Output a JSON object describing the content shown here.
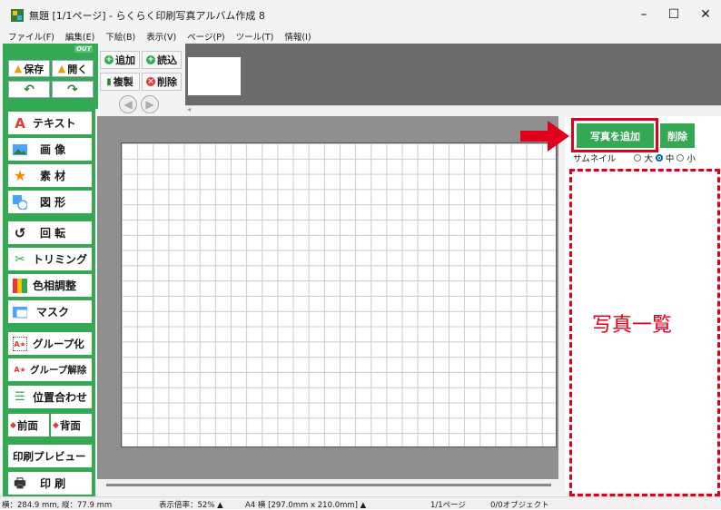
{
  "window": {
    "title": "無題 [1/1ページ] - らくらく印刷写真アルバム作成 8",
    "controls": {
      "minimize": "–",
      "maximize": "☐",
      "close": "✕"
    }
  },
  "menu": [
    "ファイル(F)",
    "編集(E)",
    "下絵(B)",
    "表示(V)",
    "ページ(P)",
    "ツール(T)",
    "情報(I)"
  ],
  "toolbar": {
    "out_label": "OUT",
    "save": "保存",
    "open": "開く",
    "undo": "↶",
    "redo": "↷",
    "add": "追加",
    "load": "読込",
    "duplicate": "複製",
    "delete": "削除",
    "prev": "◀",
    "next": "▶"
  },
  "sidebar": [
    {
      "label": "テキスト",
      "icon": "A"
    },
    {
      "label": "画 像",
      "icon": "image-icon"
    },
    {
      "label": "素 材",
      "icon": "★"
    },
    {
      "label": "図 形",
      "icon": "shape-icon"
    },
    {
      "label": "回 転",
      "icon": "rotate-icon"
    },
    {
      "label": "トリミング",
      "icon": "scissors-icon"
    },
    {
      "label": "色相調整",
      "icon": "color-icon"
    },
    {
      "label": "マスク",
      "icon": "mask-icon"
    },
    {
      "label": "グループ化",
      "icon": "group-icon"
    },
    {
      "label": "グループ解除",
      "icon": "ungroup-icon"
    },
    {
      "label": "位置合わせ",
      "icon": "align-icon"
    },
    {
      "label": "印刷プレビュー",
      "icon": ""
    },
    {
      "label": "印 刷",
      "icon": "printer-icon"
    }
  ],
  "front_back": {
    "front": "前面",
    "back": "背面"
  },
  "right_panel": {
    "add_photo": "写真を追加",
    "delete": "削除",
    "thumb_size_label": "サムネイル",
    "size_large": "大",
    "size_medium": "中",
    "size_small": "小",
    "photo_list": "写真一覧"
  },
  "status": {
    "coords": "横：284.9 mm, 縦：77.9 mm",
    "zoom": "表示倍率：52% ▲",
    "paper": "A4 横 [297.0mm x 210.0mm] ▲",
    "page": "1/1ページ",
    "objects": "0/0オブジェクト"
  },
  "colors": {
    "accent_green": "#34a853",
    "highlight_red": "#e0001b"
  }
}
